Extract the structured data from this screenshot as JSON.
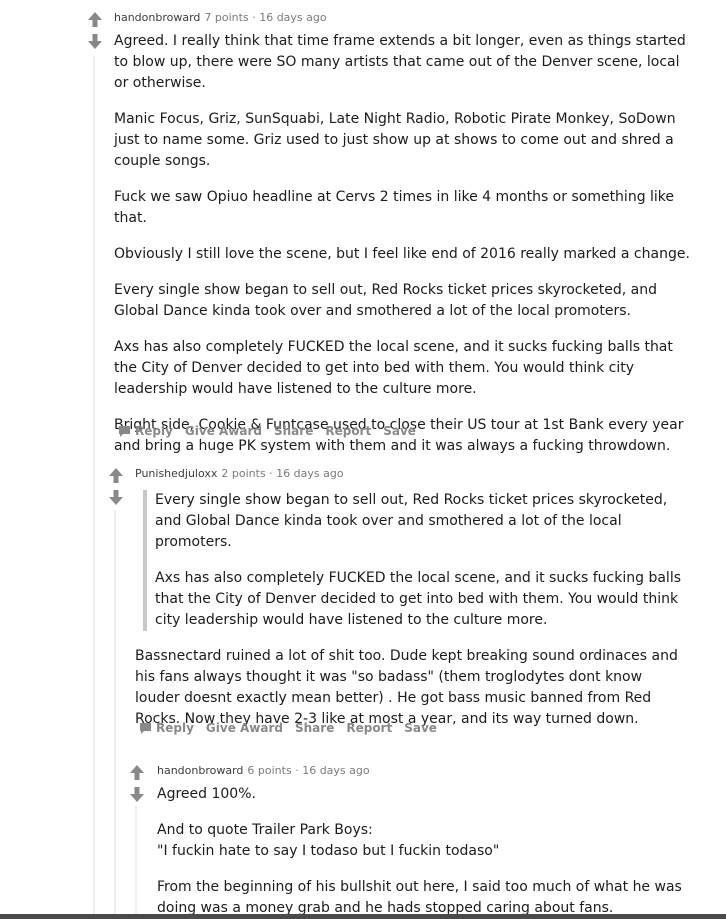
{
  "comments": [
    {
      "author": "handonbroward",
      "points": "7 points",
      "age": "16 days ago",
      "paragraphs": [
        "Agreed. I really think that time frame extends a bit longer, even as things started to blow up, there were SO many artists that came out of the Denver scene, local or otherwise.",
        "Manic Focus, Griz, SunSquabi, Late Night Radio, Robotic Pirate Monkey, SoDown just to name some. Griz used to just show up at shows to come out and shred a couple songs.",
        "Fuck we saw Opiuo headline at Cervs 2 times in like 4 months or something like that.",
        "Obviously I still love the scene, but I feel like end of 2016 really marked a change.",
        "Every single show began to sell out, Red Rocks ticket prices skyrocketed, and Global Dance kinda took over and smothered a lot of the local promoters.",
        "Axs has also completely FUCKED the local scene, and it sucks fucking balls that the City of Denver decided to get into bed with them. You would think city leadership would have listened to the culture more.",
        "Bright side, Cookie & Funtcase used to close their US tour at 1st Bank every year and bring a huge PK system with them and it was always a fucking throwdown."
      ]
    },
    {
      "author": "Punishedjuloxx",
      "points": "2 points",
      "age": "16 days ago",
      "quote": [
        "Every single show began to sell out, Red Rocks ticket prices skyrocketed, and Global Dance kinda took over and smothered a lot of the local promoters.",
        "Axs has also completely FUCKED the local scene, and it sucks fucking balls that the City of Denver decided to get into bed with them. You would think city leadership would have listened to the culture more."
      ],
      "paragraphs": [
        "Bassnectard ruined a lot of shit too. Dude kept breaking sound ordinaces and his fans always thought it was \"so badass\" (them troglodytes dont know louder doesnt exactly mean better) . He got bass music banned from Red Rocks. Now they have 2-3 like at most a year, and its way turned down."
      ]
    },
    {
      "author": "handonbroward",
      "points": "6 points",
      "age": "16 days ago",
      "paragraphs": [
        "Agreed 100%.",
        "And to quote Trailer Park Boys:\n\"I fuckin hate to say I todaso but I fuckin todaso\"",
        "From the beginning of his bullshit out here, I said too much of what he was doing was a money grab and he hads stopped caring about fans."
      ]
    }
  ],
  "actions": {
    "reply": "Reply",
    "give_award": "Give Award",
    "share": "Share",
    "report": "Report",
    "save": "Save"
  },
  "header_separator": "·",
  "icons": {
    "upvote": "arrow-up-icon",
    "downvote": "arrow-down-icon",
    "reply": "speech-bubble-icon"
  },
  "colors": {
    "arrow": "#878a8c",
    "meta": "#7c7c7c",
    "action": "#878a8c",
    "quote_border": "#c8c8c8",
    "thread_line": "#edeff1"
  }
}
